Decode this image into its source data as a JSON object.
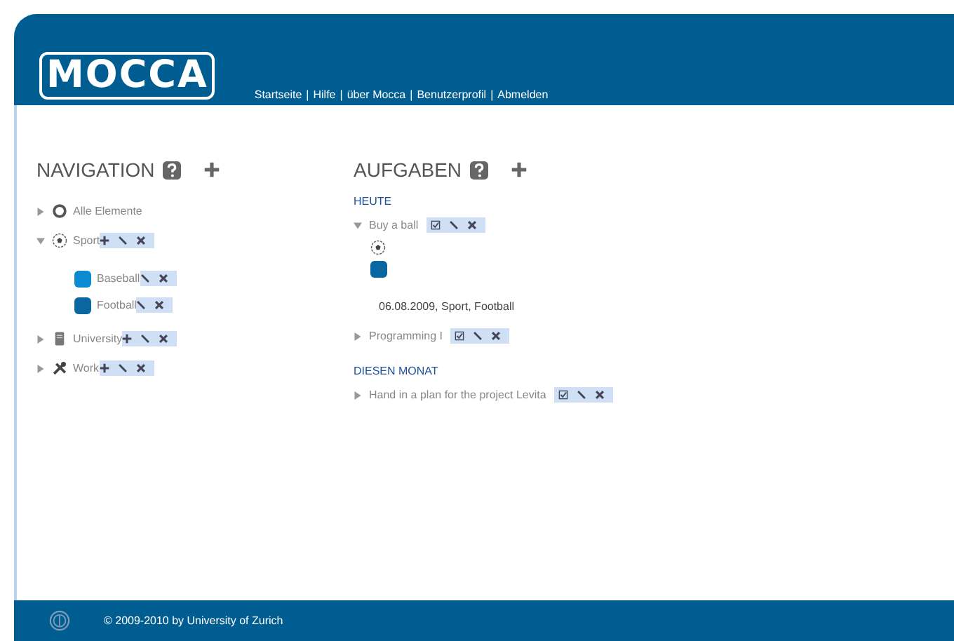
{
  "header": {
    "logo": "MOCCA",
    "links": [
      {
        "label": "Startseite"
      },
      {
        "label": "Hilfe"
      },
      {
        "label": "über Mocca"
      },
      {
        "label": "Benutzerprofil"
      },
      {
        "label": "Abmelden"
      }
    ],
    "separator": "|"
  },
  "navigation": {
    "title": "NAVIGATION",
    "items": [
      {
        "label": "Alle Elemente",
        "kind": "circle",
        "expanded": false
      },
      {
        "label": "Sport",
        "kind": "ball",
        "expanded": true,
        "actions": [
          {
            "kind": "add"
          },
          {
            "kind": "edit"
          },
          {
            "kind": "delete"
          }
        ],
        "children": [
          {
            "label": "Baseball",
            "color": "#0a8ad0",
            "actions": [
              {
                "kind": "edit"
              },
              {
                "kind": "delete"
              }
            ]
          },
          {
            "label": "Football",
            "color": "#0a66a0",
            "actions": [
              {
                "kind": "edit"
              },
              {
                "kind": "delete"
              }
            ]
          }
        ]
      },
      {
        "label": "University",
        "kind": "book",
        "expanded": false,
        "actions": [
          {
            "kind": "add"
          },
          {
            "kind": "edit"
          },
          {
            "kind": "delete"
          }
        ]
      },
      {
        "label": "Work",
        "kind": "tools",
        "expanded": false,
        "actions": [
          {
            "kind": "add"
          },
          {
            "kind": "edit"
          },
          {
            "kind": "delete"
          }
        ]
      }
    ]
  },
  "tasks": {
    "title": "AUFGABEN",
    "groups": [
      {
        "heading": "HEUTE",
        "items": [
          {
            "label": "Buy a ball",
            "expanded": true,
            "actions": [
              {
                "kind": "done"
              },
              {
                "kind": "edit"
              },
              {
                "kind": "delete"
              }
            ],
            "detail": {
              "color": "#0a66a0",
              "info": "06.08.2009, Sport, Football"
            }
          },
          {
            "label": "Programming I",
            "expanded": false,
            "actions": [
              {
                "kind": "done"
              },
              {
                "kind": "edit"
              },
              {
                "kind": "delete"
              }
            ]
          }
        ]
      },
      {
        "heading": "DIESEN MONAT",
        "items": [
          {
            "label": "Hand in a plan for the project Levita",
            "expanded": false,
            "actions": [
              {
                "kind": "done"
              },
              {
                "kind": "edit"
              },
              {
                "kind": "delete"
              }
            ]
          }
        ]
      }
    ]
  },
  "footer": {
    "text": "© 2009-2010 by University of Zurich"
  }
}
